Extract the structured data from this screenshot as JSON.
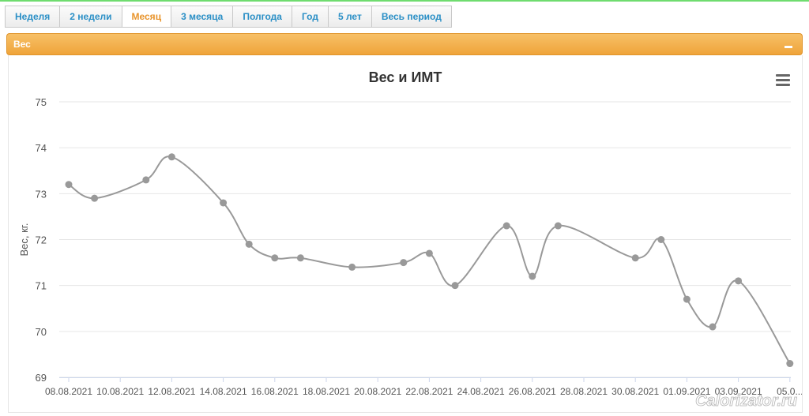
{
  "tabs": [
    "Неделя",
    "2 недели",
    "Месяц",
    "3 месяца",
    "Полгода",
    "Год",
    "5 лет",
    "Весь период"
  ],
  "active_tab": "Месяц",
  "panel": {
    "title": "Вес"
  },
  "watermark": "Calorizator.ru",
  "colors": {
    "accent": "#efa43a",
    "link": "#2a8fc6",
    "line": "#999999"
  },
  "chart_data": {
    "type": "line",
    "title": "Вес и ИМТ",
    "xlabel": "",
    "ylabel": "Вес, кг.",
    "ylim": [
      69,
      75
    ],
    "yticks": [
      69,
      70,
      71,
      72,
      73,
      74,
      75
    ],
    "grid": true,
    "xticks": [
      "08.08.2021",
      "10.08.2021",
      "12.08.2021",
      "14.08.2021",
      "16.08.2021",
      "18.08.2021",
      "20.08.2021",
      "22.08.2021",
      "24.08.2021",
      "26.08.2021",
      "28.08.2021",
      "30.08.2021",
      "01.09.2021",
      "03.09.2021",
      "05.0..."
    ],
    "series": [
      {
        "x": [
          "08.08.2021",
          "09.08.2021",
          "11.08.2021",
          "12.08.2021",
          "14.08.2021",
          "15.08.2021",
          "16.08.2021",
          "17.08.2021",
          "19.08.2021",
          "21.08.2021",
          "22.08.2021",
          "23.08.2021",
          "25.08.2021",
          "26.08.2021",
          "27.08.2021",
          "30.08.2021",
          "31.08.2021",
          "01.09.2021",
          "02.09.2021",
          "03.09.2021",
          "05.09.2021"
        ],
        "values": [
          73.2,
          72.9,
          73.3,
          73.8,
          72.8,
          71.9,
          71.6,
          71.6,
          71.4,
          71.5,
          71.7,
          71.0,
          72.3,
          71.2,
          72.3,
          71.6,
          72.0,
          70.7,
          70.1,
          71.1,
          69.3
        ]
      }
    ]
  }
}
